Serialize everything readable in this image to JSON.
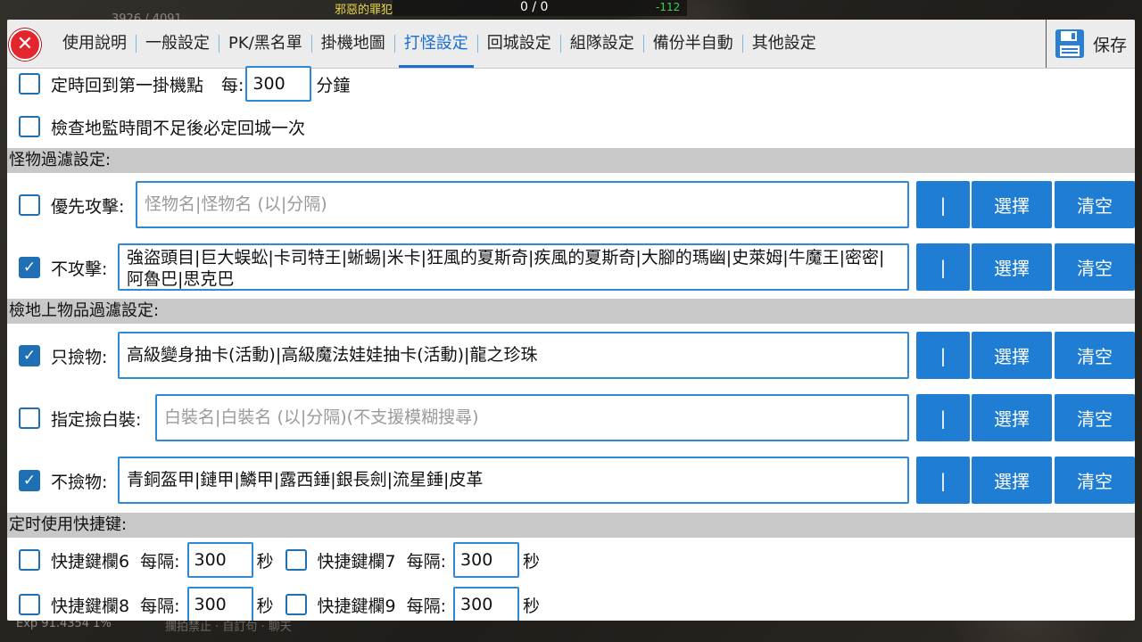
{
  "hud": {
    "hp": "3926 / 4091",
    "player_name": "邪惡的罪犯",
    "score": "0 / 0",
    "delta": "-112",
    "exp": "Exp  91.4354 1%",
    "bottom_misc": "攔拍禁止 · 自訂句 · 聊天"
  },
  "tabs": [
    {
      "label": "使用說明"
    },
    {
      "label": "一般設定"
    },
    {
      "label": "PK/黑名單"
    },
    {
      "label": "掛機地圖"
    },
    {
      "label": "打怪設定",
      "active": true
    },
    {
      "label": "回城設定"
    },
    {
      "label": "組隊設定"
    },
    {
      "label": "備份半自動"
    },
    {
      "label": "其他設定"
    }
  ],
  "save_label": "保存",
  "return_timer": {
    "label": "定時回到第一掛機點",
    "every": "每:",
    "value": "300",
    "unit": "分鐘",
    "checked": false
  },
  "check_map_time": {
    "label": "檢查地監時間不足後必定回城一次",
    "checked": false
  },
  "monster_section": "怪物過濾設定:",
  "priority_attack": {
    "label": "優先攻擊:",
    "placeholder": "怪物名|怪物名 (以|分隔)",
    "checked": false
  },
  "no_attack": {
    "label": "不攻擊:",
    "value": "強盜頭目|巨大蜈蚣|卡司特王|蜥蜴|米卡|狂風的夏斯奇|疾風的夏斯奇|大腳的瑪幽|史萊姆|牛魔王|密密|阿魯巴|思克巴",
    "checked": true
  },
  "item_section": "檢地上物品過濾設定:",
  "pick_only": {
    "label": "只撿物:",
    "value": "高級變身抽卡(活動)|高級魔法娃娃抽卡(活動)|龍之珍珠",
    "checked": true
  },
  "pick_white": {
    "label": "指定撿白裝:",
    "placeholder": "白裝名|白裝名 (以|分隔)(不支援模糊搜尋)",
    "checked": false
  },
  "no_pick": {
    "label": "不撿物:",
    "value": "青銅盔甲|鏈甲|鱗甲|露西錘|銀長劍|流星錘|皮革",
    "checked": true
  },
  "hotkey_section": "定时使用快捷键:",
  "buttons": {
    "pipe": "|",
    "select": "選擇",
    "clear": "清空"
  },
  "hotkeys": [
    {
      "label": "快捷鍵欄6",
      "every": "每隔:",
      "value": "300",
      "unit": "秒",
      "checked": false
    },
    {
      "label": "快捷鍵欄7",
      "every": "每隔:",
      "value": "300",
      "unit": "秒",
      "checked": false
    },
    {
      "label": "快捷鍵欄8",
      "every": "每隔:",
      "value": "300",
      "unit": "秒",
      "checked": false
    },
    {
      "label": "快捷鍵欄9",
      "every": "每隔:",
      "value": "300",
      "unit": "秒",
      "checked": false
    }
  ]
}
